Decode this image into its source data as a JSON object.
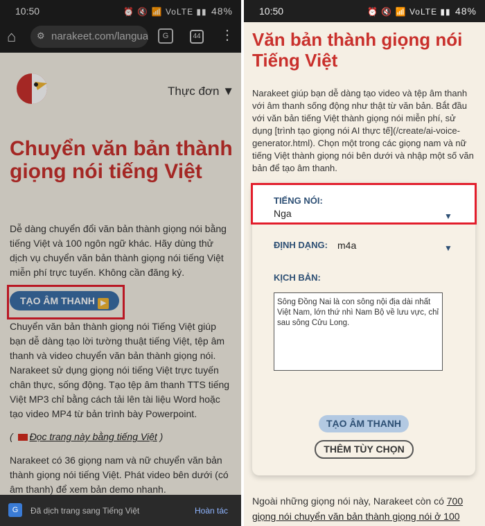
{
  "status": {
    "time": "10:50",
    "signal": "VoLTE",
    "battery": "48%"
  },
  "browser": {
    "url": "narakeet.com/languag",
    "tabs_count": "44"
  },
  "left": {
    "menu_label": "Thực đơn",
    "title": "Chuyển văn bản thành giọng nói tiếng Việt",
    "intro": "Dễ dàng chuyển đổi văn bản thành giọng nói bằng tiếng Việt và 100 ngôn ngữ khác. Hãy dùng thử dịch vụ chuyển văn bản thành giọng nói tiếng Việt miễn phí trực tuyến. Không cần đăng ký.",
    "cta_label": "TẠO ÂM THANH",
    "body": "Chuyển văn bản thành giọng nói Tiếng Việt giúp bạn dễ dàng tạo lời tường thuật tiếng Việt, tệp âm thanh và video chuyển văn bản thành giọng nói. Narakeet sử dụng giọng nói tiếng Việt trực tuyến chân thực, sống động. Tạo tệp âm thanh TTS tiếng Việt MP3 chỉ bằng cách tải lên tài liệu Word hoặc tạo video MP4 từ bản trình bày Powerpoint.",
    "read_link": "Đọc trang này bằng tiếng Việt",
    "voices_text": "Narakeet có 36 giọng nam và nữ chuyển văn bản thành giọng nói tiếng Việt. Phát video bên dưới (có âm thanh) để xem bản demo nhanh.",
    "translate_msg": "Đã dịch trang sang Tiếng Việt",
    "translate_undo": "Hoàn tác"
  },
  "right": {
    "title": "Văn bản thành giọng nói Tiếng Việt",
    "intro": "Narakeet giúp bạn dễ dàng tạo video và tệp âm thanh với âm thanh sống động như thật từ văn bản. Bắt đầu với văn bản tiếng Việt thành giọng nói miễn phí, sử dụng [trình tạo giọng nói AI thực tế](/create/ai-voice-generator.html). Chọn một trong các giọng nam và nữ tiếng Việt thành giọng nói bên dưới và nhập một số văn bản để tạo âm thanh.",
    "voice_label": "TIẾNG NÓI:",
    "voice_value": "Nga",
    "format_label": "ĐỊNH DẠNG:",
    "format_value": "m4a",
    "script_label": "KỊCH BẢN:",
    "script_text": "Sông Đồng Nai là con sông nội địa dài nhất Việt Nam, lớn thứ nhì Nam Bộ về lưu vực, chỉ sau sông Cửu Long.",
    "primary_button": "TẠO ÂM THANH",
    "secondary_button": "THÊM TÙY CHỌN",
    "footer_prefix": "Ngoài những giọng nói này, Narakeet còn có ",
    "footer_link": "700 giọng nói chuyển văn bản thành giọng nói ở 100"
  },
  "colors": {
    "accent_red": "#c9302c",
    "highlight": "#e21d2b",
    "button_blue": "#3b6ea6",
    "label_navy": "#2d4f74"
  }
}
